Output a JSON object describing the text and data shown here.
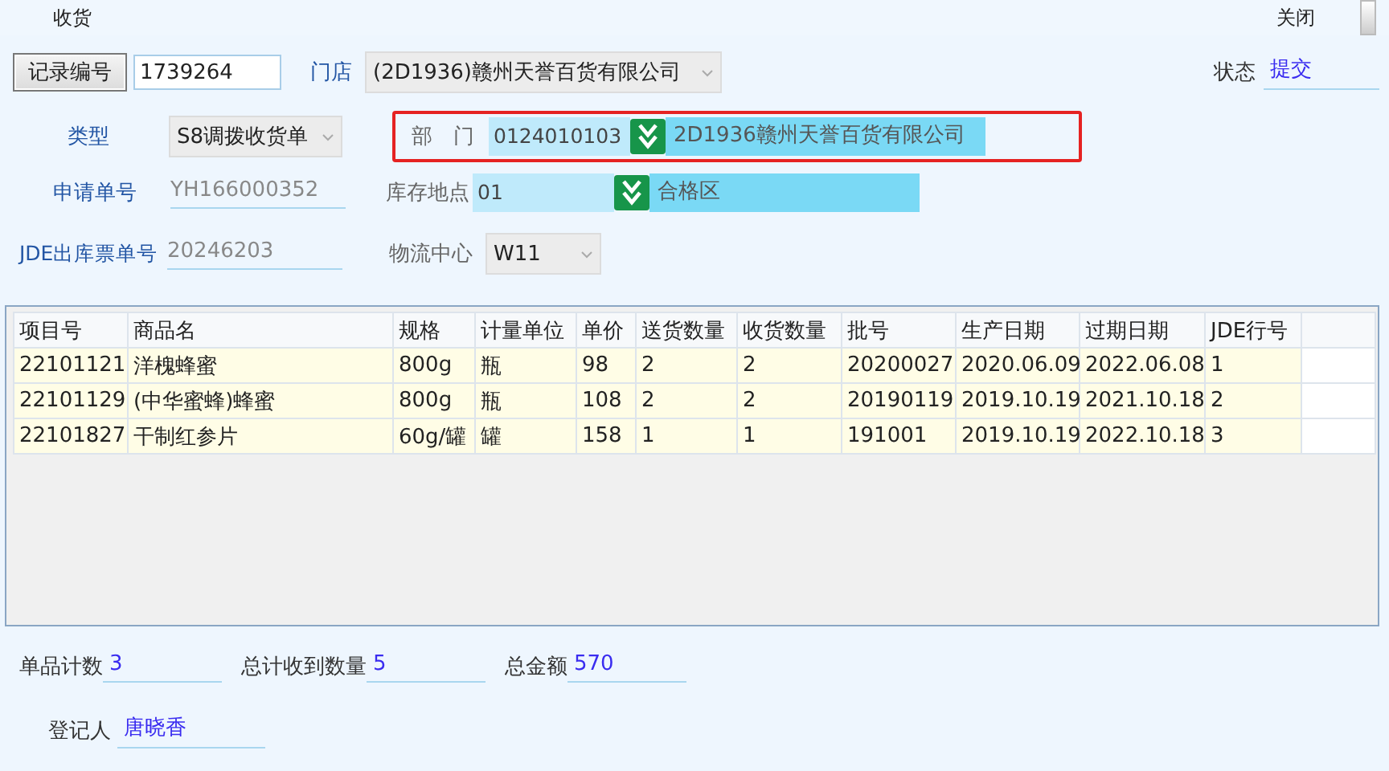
{
  "window": {
    "title": "收货",
    "close": "关闭"
  },
  "record": {
    "button": "记录编号",
    "value": "1739264"
  },
  "store": {
    "label": "门店",
    "value": "(2D1936)赣州天誉百货有限公司"
  },
  "status": {
    "label": "状态",
    "value": "提交"
  },
  "type": {
    "label": "类型",
    "value": "S8调拨收货单"
  },
  "department": {
    "label": "部　门",
    "code": "0124010103",
    "name": "2D1936赣州天誉百货有限公司",
    "highlighted": true
  },
  "request_no": {
    "label": "申请单号",
    "value": "YH166000352"
  },
  "storage_location": {
    "label": "库存地点",
    "code": "01",
    "name": "合格区",
    "highlighted": false
  },
  "jde_no": {
    "label": "JDE出库票单号",
    "value": "20246203"
  },
  "logistics_center": {
    "label": "物流中心",
    "value": "W11"
  },
  "table": {
    "columns": [
      "项目号",
      "商品名",
      "规格",
      "计量单位",
      "单价",
      "送货数量",
      "收货数量",
      "批号",
      "生产日期",
      "过期日期",
      "JDE行号"
    ],
    "rows": [
      [
        "22101121",
        "洋槐蜂蜜",
        "800g",
        "瓶",
        "98",
        "2",
        "2",
        "20200027",
        "2020.06.09",
        "2022.06.08",
        "1"
      ],
      [
        "22101129",
        "(中华蜜蜂)蜂蜜",
        "800g",
        "瓶",
        "108",
        "2",
        "2",
        "20190119",
        "2019.10.19",
        "2021.10.18",
        "2"
      ],
      [
        "22101827",
        "干制红参片",
        "60g/罐",
        "罐",
        "158",
        "1",
        "1",
        "191001",
        "2019.10.19",
        "2022.10.18",
        "3"
      ]
    ]
  },
  "totals": [
    {
      "label": "单品计数",
      "value": "3"
    },
    {
      "label": "总计收到数量",
      "value": "5"
    },
    {
      "label": "总金额",
      "value": "570"
    }
  ],
  "registrar": {
    "label": "登记人",
    "value": "唐晓香"
  }
}
